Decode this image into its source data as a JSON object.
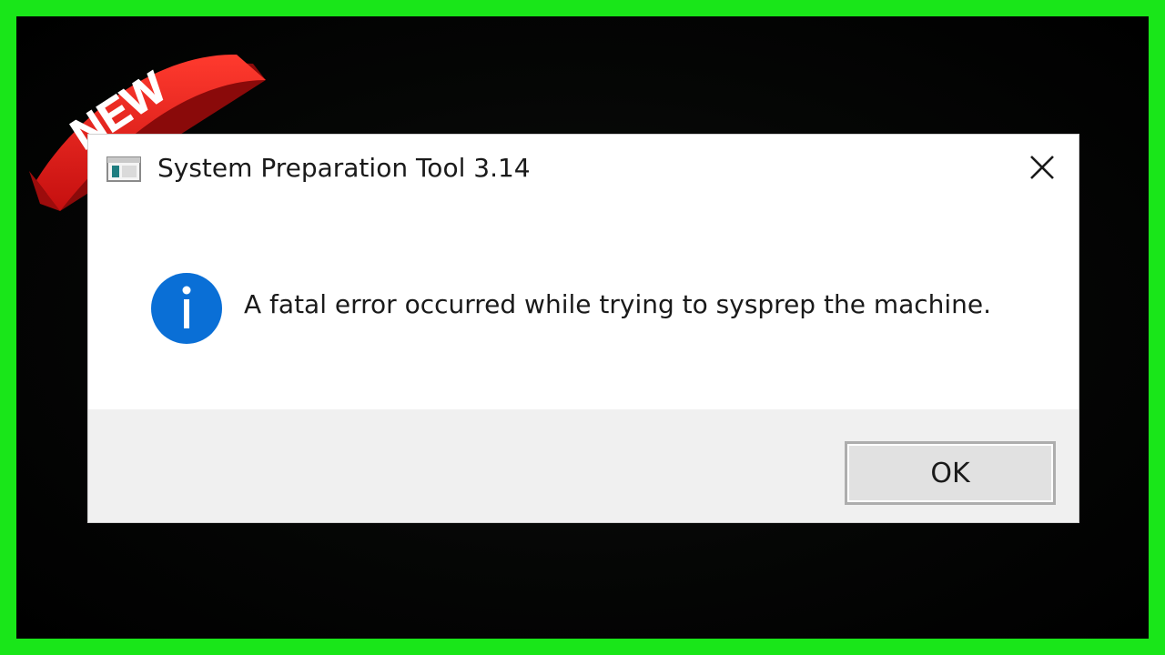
{
  "badge": {
    "label": "NEW",
    "color": "#e61919"
  },
  "dialog": {
    "title": "System Preparation Tool 3.14",
    "app_icon": "window-app-icon",
    "close_icon": "close-icon",
    "info_icon": "info-icon",
    "message": "A fatal error occurred while trying to sysprep the machine.",
    "ok_label": "OK"
  },
  "colors": {
    "frame": "#19e619",
    "info_blue": "#0a6fd6",
    "footer_bg": "#f0f0f0"
  }
}
